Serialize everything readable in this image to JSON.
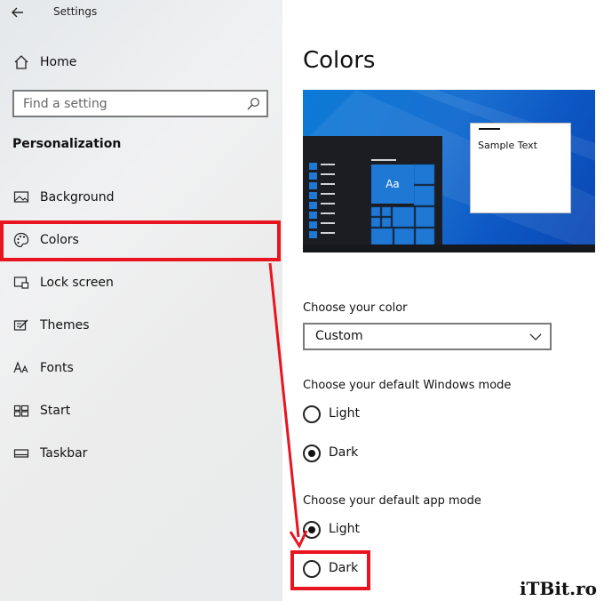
{
  "window": {
    "title": "Settings"
  },
  "sidebar": {
    "home_label": "Home",
    "search_placeholder": "Find a setting",
    "section_title": "Personalization",
    "items": [
      {
        "label": "Background",
        "icon": "picture-icon"
      },
      {
        "label": "Colors",
        "icon": "palette-icon"
      },
      {
        "label": "Lock screen",
        "icon": "lock-screen-icon"
      },
      {
        "label": "Themes",
        "icon": "themes-icon"
      },
      {
        "label": "Fonts",
        "icon": "fonts-icon"
      },
      {
        "label": "Start",
        "icon": "start-icon"
      },
      {
        "label": "Taskbar",
        "icon": "taskbar-icon"
      }
    ],
    "selected": "Colors"
  },
  "main": {
    "page_title": "Colors",
    "preview": {
      "sample_text": "Sample Text",
      "tile_text": "Aa"
    },
    "choose_color": {
      "label": "Choose your color",
      "value": "Custom"
    },
    "windows_mode": {
      "label": "Choose your default Windows mode",
      "options": [
        {
          "label": "Light",
          "selected": false
        },
        {
          "label": "Dark",
          "selected": true
        }
      ]
    },
    "app_mode": {
      "label": "Choose your default app mode",
      "options": [
        {
          "label": "Light",
          "selected": true
        },
        {
          "label": "Dark",
          "selected": false
        }
      ]
    }
  },
  "colors": {
    "highlight": "#e8141f",
    "accent": "#1a6fd0"
  },
  "watermark": "iTBit.ro"
}
